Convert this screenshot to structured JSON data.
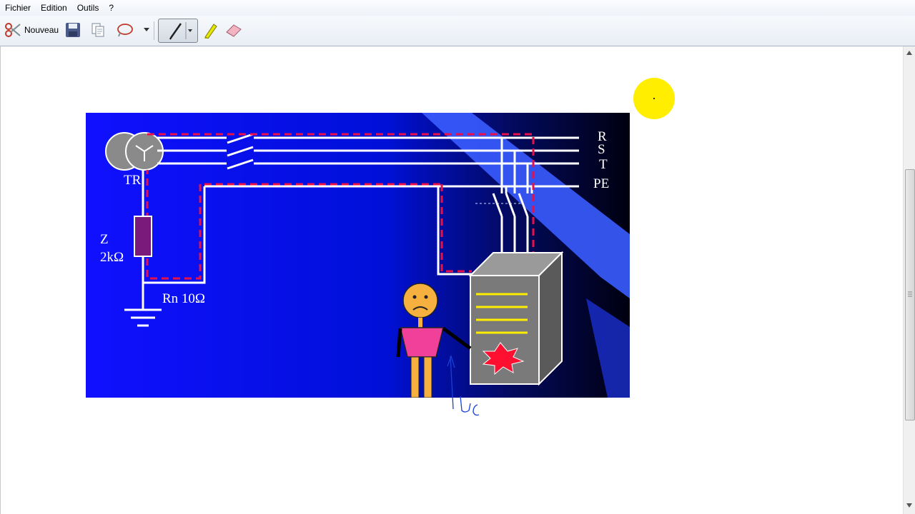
{
  "menu": {
    "items": [
      "Fichier",
      "Edition",
      "Outils",
      "?"
    ]
  },
  "toolbar": {
    "new_label": "Nouveau"
  },
  "diagram": {
    "phase_labels": [
      "R",
      "S",
      "T",
      "PE"
    ],
    "transformer_label": "TR",
    "impedance_label_line1": "Z",
    "impedance_label_line2": "2kΩ",
    "neutral_resistance_label": "Rn 10Ω"
  },
  "annotation": {
    "handwritten_text": "Uc"
  },
  "colors": {
    "slide_background": "#0000ee",
    "fault_path": "#e8104a",
    "wire": "#ffffff",
    "impedance": "#7a1a7a",
    "pointer": "#ffee00",
    "ink": "#1a3fd6"
  }
}
